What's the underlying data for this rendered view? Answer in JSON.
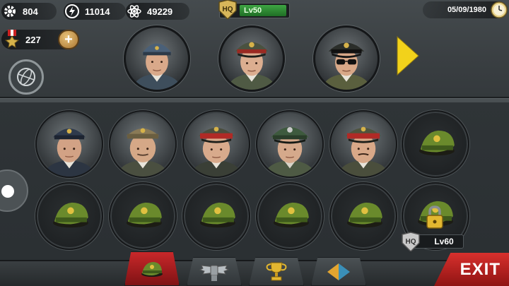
{
  "resources": {
    "gear": "804",
    "power": "11014",
    "atom": "49229",
    "medals": "227"
  },
  "hq": {
    "badge": "HQ",
    "level": "Lv50"
  },
  "date": "05/09/1980",
  "generals_top": [
    {
      "name": "general-portrait-1",
      "cap": "blue-cap"
    },
    {
      "name": "general-portrait-2",
      "cap": "peaked-cap"
    },
    {
      "name": "general-portrait-3",
      "cap": "sunglasses"
    }
  ],
  "generals_grid": [
    {
      "state": "portrait",
      "cap": "navy"
    },
    {
      "state": "portrait",
      "cap": "khaki"
    },
    {
      "state": "portrait",
      "cap": "red-band"
    },
    {
      "state": "portrait",
      "cap": "green"
    },
    {
      "state": "portrait",
      "cap": "red-band"
    },
    {
      "state": "empty"
    },
    {
      "state": "empty"
    },
    {
      "state": "empty"
    },
    {
      "state": "empty"
    },
    {
      "state": "empty"
    },
    {
      "state": "empty"
    },
    {
      "state": "locked"
    }
  ],
  "locked_slot": {
    "badge": "HQ",
    "level": "Lv60"
  },
  "tabs": [
    {
      "name": "generals-tab",
      "icon": "cap-icon",
      "active": true
    },
    {
      "name": "rank-tab",
      "icon": "wings-icon",
      "active": false
    },
    {
      "name": "trophy-tab",
      "icon": "trophy-icon",
      "active": false
    },
    {
      "name": "diamond-tab",
      "icon": "diamond-icon",
      "active": false
    }
  ],
  "exit_label": "EXIT",
  "colors": {
    "accent_red": "#c9282a",
    "hq_green": "#3ea543",
    "arrow_yellow": "#f2d21b",
    "cap_green": "#6a8a2c"
  }
}
